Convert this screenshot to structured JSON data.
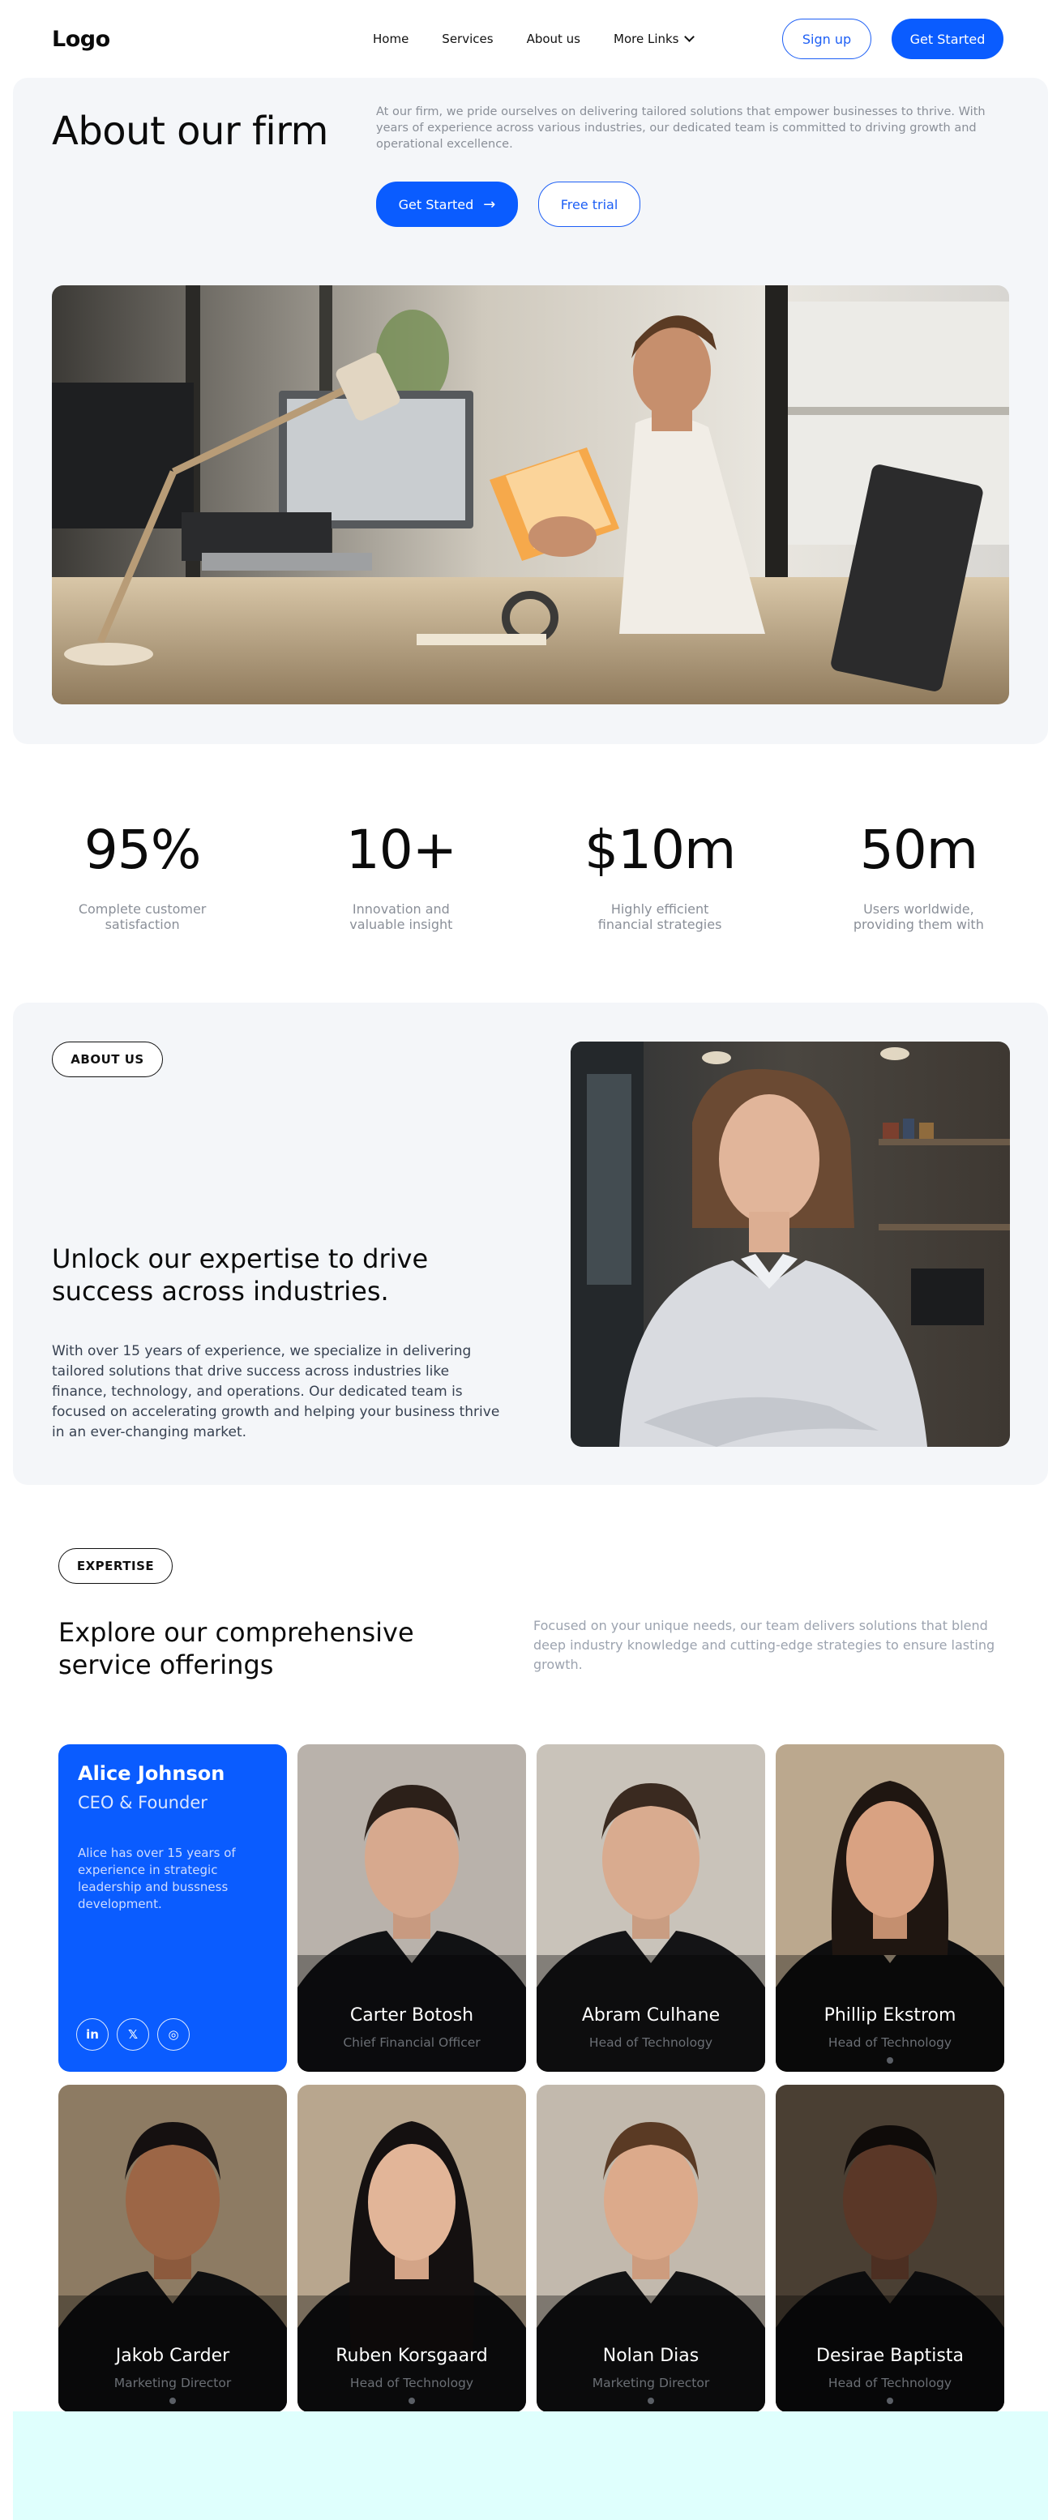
{
  "nav": {
    "logo": "Logo",
    "links": [
      "Home",
      "Services",
      "About us",
      "More Links"
    ],
    "signup": "Sign up",
    "get_started": "Get Started"
  },
  "hero": {
    "title": "About our firm",
    "description": "At our firm, we pride ourselves on delivering tailored solutions that empower businesses to thrive. With years of experience across various industries, our dedicated team is committed to driving growth and operational excellence.",
    "primary_button": "Get Started",
    "secondary_button": "Free trial"
  },
  "stats": [
    {
      "value": "95%",
      "label": "Complete customer satisfaction"
    },
    {
      "value": "10+",
      "label": "Innovation and valuable insight"
    },
    {
      "value": "$10m",
      "label": "Highly efficient financial strategies"
    },
    {
      "value": "50m",
      "label": "Users worldwide, providing them with"
    }
  ],
  "about": {
    "tag": "ABOUT US",
    "heading": "Unlock our expertise to drive success across industries.",
    "paragraph": "With over 15 years of experience, we specialize in delivering tailored solutions that drive success across industries like finance, technology, and operations. Our dedicated team is focused on accelerating growth and helping your business thrive in an ever-changing market."
  },
  "expertise": {
    "tag": "EXPERTISE",
    "heading": "Explore our comprehensive service offerings",
    "paragraph": "Focused on your unique needs, our team delivers solutions that blend deep industry knowledge and cutting-edge strategies to ensure lasting growth."
  },
  "featured": {
    "name": "Alice Johnson",
    "role": "CEO & Founder",
    "bio": "Alice has over 15 years of experience in strategic leadership and bussness development.",
    "socials": [
      "in",
      "𝕏",
      "◎"
    ]
  },
  "team": [
    {
      "name": "Carter Botosh",
      "role": "Chief Financial Officer"
    },
    {
      "name": "Abram Culhane",
      "role": "Head of Technology"
    },
    {
      "name": "Phillip Ekstrom",
      "role": "Head of Technology"
    },
    {
      "name": "Jakob Carder",
      "role": "Marketing Director"
    },
    {
      "name": "Ruben Korsgaard",
      "role": "Head of Technology"
    },
    {
      "name": "Nolan Dias",
      "role": "Marketing Director"
    },
    {
      "name": "Desirae Baptista",
      "role": "Head of Technology"
    }
  ],
  "colors": {
    "accent": "#0a5cff",
    "panel": "#f4f6f9",
    "band": "#dffffd"
  }
}
